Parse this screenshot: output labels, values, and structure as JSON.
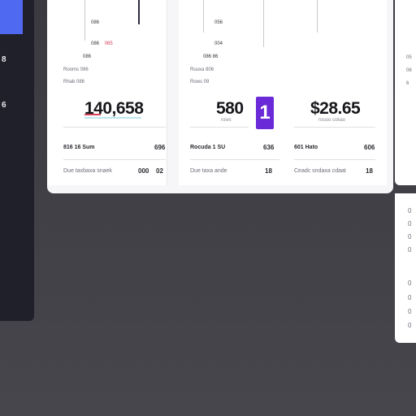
{
  "sidebar": {
    "numbers": [
      "8",
      "6"
    ]
  },
  "cards": [
    {
      "top_labels": [
        "086",
        "086",
        "065",
        "086"
      ],
      "mini_rows": [
        "Rooms 086",
        "Rhab 086"
      ],
      "value": "140,658",
      "row1": {
        "label": "816 16 Sum",
        "value": "696"
      },
      "row2": {
        "label": "Due taxbaxa snaek",
        "value": "000",
        "value2": "02"
      }
    },
    {
      "top_labels": [
        "056",
        "004",
        "086 86"
      ],
      "mini_rows": [
        "Ruuxa 806",
        "Rows 09"
      ],
      "value": "580",
      "sub": "rows",
      "row1": {
        "label": "Rocuda 1 SU",
        "value": "636"
      },
      "row2": {
        "label": "Due taxa ande",
        "value": "18"
      }
    },
    {
      "value": "$28.65",
      "sub": "rouoo cokao",
      "row1": {
        "label": "601 Hato",
        "value": "606"
      },
      "row2": {
        "label": "Ceadc sndaxa cdaat",
        "value": "18"
      }
    }
  ],
  "badge": "1",
  "right_panel": {
    "labels": [
      "05",
      "06",
      "6"
    ],
    "dots": [
      "0",
      "0",
      "0",
      "0",
      "0",
      "0",
      "0",
      "0"
    ]
  }
}
